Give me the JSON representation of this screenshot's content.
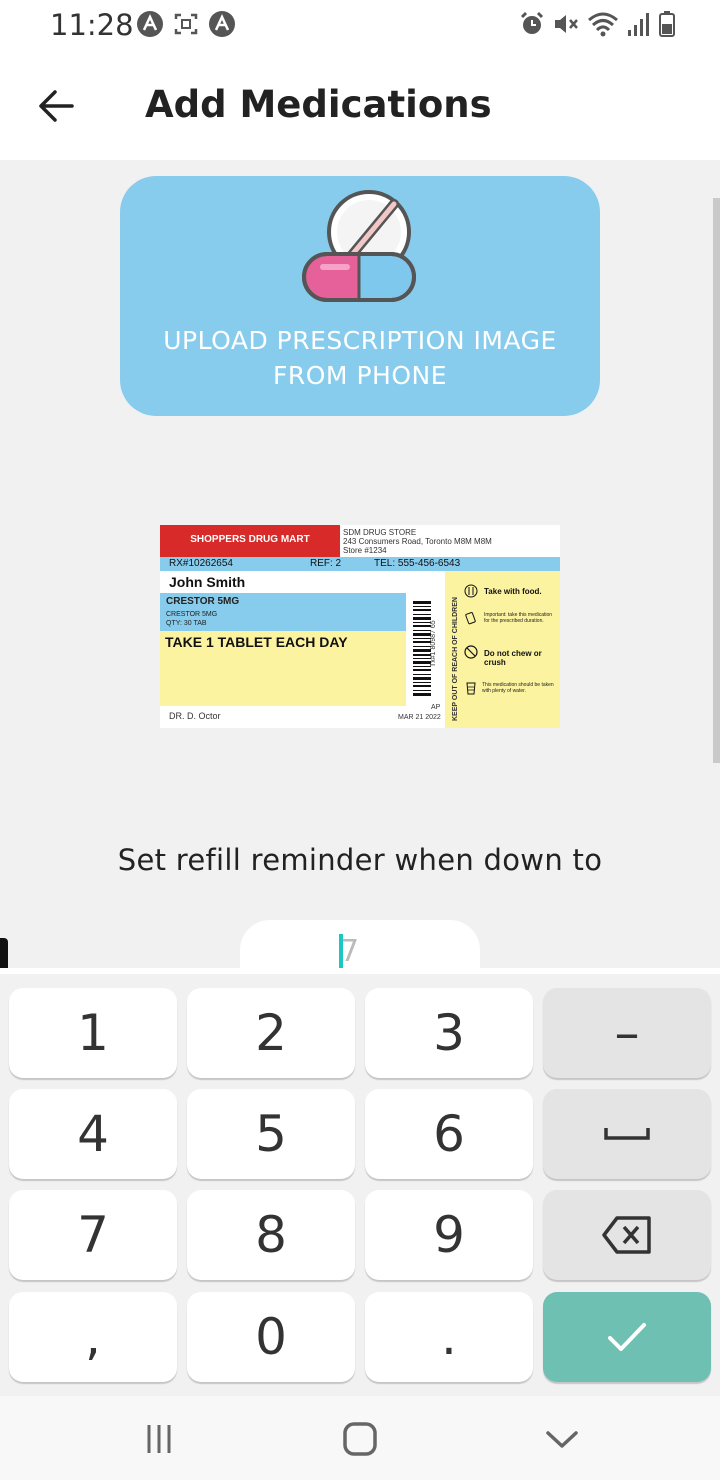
{
  "status_bar": {
    "time": "11:28",
    "left_icons": [
      "assistant-icon",
      "screenshot-icon",
      "assistant-icon"
    ],
    "right_icons": [
      "alarm-icon",
      "mute-icon",
      "wifi-icon",
      "signal-icon",
      "battery-icon"
    ]
  },
  "app_bar": {
    "back_icon": "arrow-left-icon",
    "title": "Add Medications"
  },
  "upload": {
    "icon": "pill-icon",
    "line1": "UPLOAD PRESCRIPTION IMAGE",
    "line2": "FROM PHONE",
    "color": "#87cced"
  },
  "prescription": {
    "brand": "SHOPPERS DRUG MART",
    "store_line1": "SDM DRUG STORE",
    "store_line2": "243 Consumers Road, Toronto  M8M M8M",
    "store_line3": "Store #1234",
    "rx_number": "RX#10262654",
    "refills": "REF: 2",
    "phone": "TEL: 555-456-6543",
    "patient": "John Smith",
    "drug": "CRESTOR 5MG",
    "drug_sub1": "CRESTOR 5MG",
    "drug_sub2": "QTY: 30 TAB",
    "instructions": "TAKE 1 TABLET EACH DAY",
    "doctor": "DR. D. Octor",
    "ap": "AP",
    "date": "MAR 21 2022",
    "barcode_text": "Tx#1 80987 65",
    "vertical_warning": "KEEP OUT OF REACH OF CHILDREN",
    "warn1": "Take with food.",
    "warn2": "Important: take this medication for the prescribed duration.",
    "warn3": "Do not chew or crush",
    "warn4": "This medication should be taken with plenty of water.",
    "red": "#d92a2a",
    "blue": "#87cced",
    "yellow": "#fbf3a0"
  },
  "reminder": {
    "label": "Set refill reminder when down to",
    "input_placeholder": "7",
    "accent": "#1bc8c1"
  },
  "keyboard": {
    "rows": [
      [
        "1",
        "2",
        "3",
        "–"
      ],
      [
        "4",
        "5",
        "6",
        "space"
      ],
      [
        "7",
        "8",
        "9",
        "backspace"
      ],
      [
        ",",
        "0",
        ".",
        "done"
      ]
    ],
    "enter_color": "#6ec0b3"
  },
  "nav_bar": {
    "buttons": [
      "recents-icon",
      "home-icon",
      "back-chevron-icon"
    ]
  }
}
